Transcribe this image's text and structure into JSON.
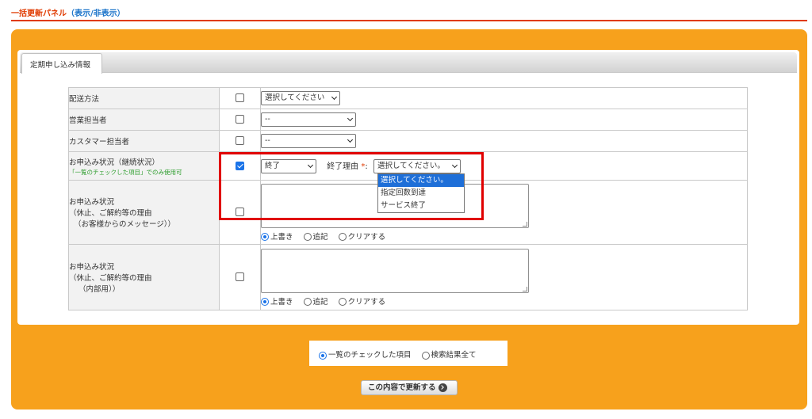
{
  "panel": {
    "title": "一括更新パネル",
    "toggle_open": "（",
    "toggle_label": "表示/非表示",
    "toggle_close": "）"
  },
  "tabs": [
    {
      "label": "定期申し込み情報"
    }
  ],
  "rows": {
    "shipping": {
      "label": "配送方法",
      "select_value": "選択してください"
    },
    "sales_rep": {
      "label": "営業担当者",
      "select_value": "--"
    },
    "cs_rep": {
      "label": "カスタマー担当者",
      "select_value": "--"
    },
    "status": {
      "label": "お申込み状況（継続状況）",
      "note": "「一覧のチェックした項目」でのみ使用可",
      "checked": true,
      "select_value": "終了",
      "reason_label": "終了理由",
      "required_mark": "*",
      "colon": ":",
      "reason_select_value": "選択してください。",
      "reason_options": [
        "選択してください。",
        "指定回数到達",
        "サービス終了"
      ],
      "reason_selected_index": 0
    },
    "reason_customer": {
      "label_lines": [
        "お申込み状況",
        "（休止、ご解約等の理由",
        "（お客様からのメッセージ））"
      ],
      "radios": [
        "上書き",
        "追記",
        "クリアする"
      ],
      "selected_radio": 0
    },
    "reason_internal": {
      "label_lines": [
        "お申込み状況",
        "（休止、ご解約等の理由",
        "（内部用））"
      ],
      "radios": [
        "上書き",
        "追記",
        "クリアする"
      ],
      "selected_radio": 0
    }
  },
  "scope": {
    "options": [
      "一覧のチェックした項目",
      "検索結果全て"
    ],
    "selected": 0
  },
  "update_button": {
    "label": "この内容で更新する"
  },
  "colors": {
    "accent_orange": "#f7a11c",
    "title_red": "#e03a00",
    "link_blue": "#1a73c9",
    "highlight_red": "#e00000"
  }
}
